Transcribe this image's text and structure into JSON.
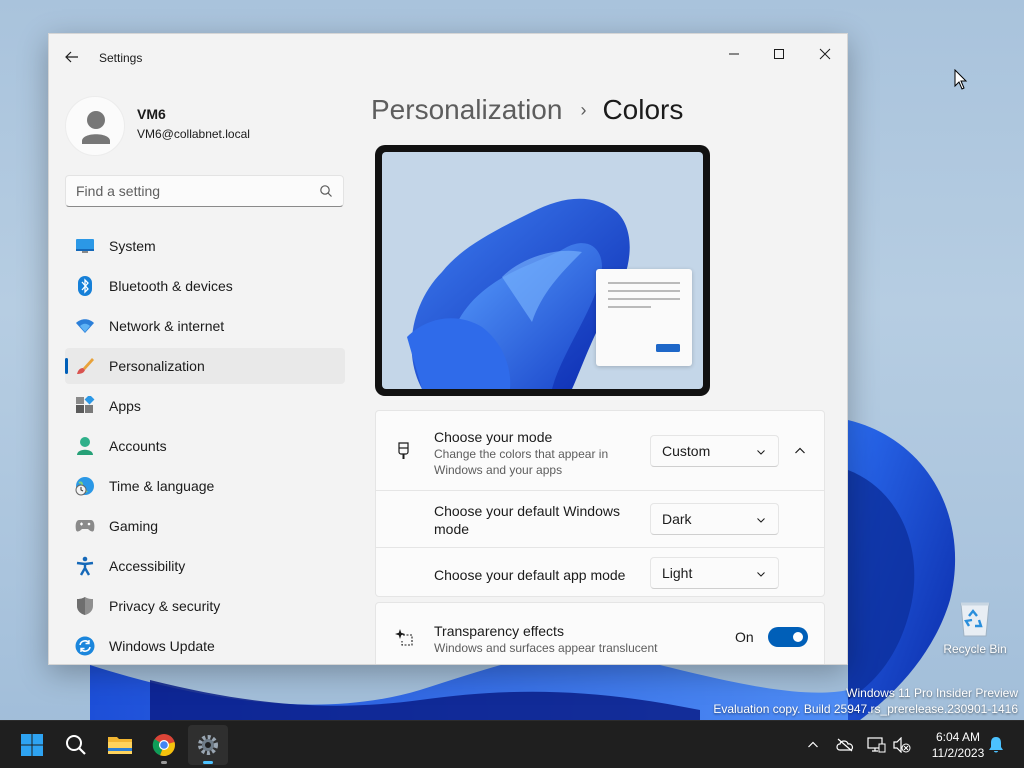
{
  "window": {
    "title": "Settings"
  },
  "profile": {
    "name": "VM6",
    "email": "VM6@collabnet.local"
  },
  "search": {
    "placeholder": "Find a setting"
  },
  "sidebar": {
    "items": [
      {
        "label": "System",
        "icon": "monitor-icon"
      },
      {
        "label": "Bluetooth & devices",
        "icon": "bluetooth-icon"
      },
      {
        "label": "Network & internet",
        "icon": "wifi-icon"
      },
      {
        "label": "Personalization",
        "icon": "paintbrush-icon",
        "active": true
      },
      {
        "label": "Apps",
        "icon": "apps-icon"
      },
      {
        "label": "Accounts",
        "icon": "person-icon"
      },
      {
        "label": "Time & language",
        "icon": "globe-clock-icon"
      },
      {
        "label": "Gaming",
        "icon": "gamepad-icon"
      },
      {
        "label": "Accessibility",
        "icon": "accessibility-icon"
      },
      {
        "label": "Privacy & security",
        "icon": "shield-icon"
      },
      {
        "label": "Windows Update",
        "icon": "update-icon"
      }
    ]
  },
  "main": {
    "breadcrumb_parent": "Personalization",
    "breadcrumb_separator": "›",
    "breadcrumb_current": "Colors",
    "mode_card": {
      "title": "Choose your mode",
      "description": "Change the colors that appear in Windows and your apps",
      "value": "Custom",
      "expanded": true,
      "windows_mode_title": "Choose your default Windows mode",
      "windows_mode_value": "Dark",
      "app_mode_title": "Choose your default app mode",
      "app_mode_value": "Light"
    },
    "transparency_card": {
      "title": "Transparency effects",
      "description": "Windows and surfaces appear translucent",
      "state_label": "On",
      "on": true
    }
  },
  "desktop": {
    "recycle_bin_label": "Recycle Bin",
    "watermark_line1": "Windows 11 Pro Insider Preview",
    "watermark_line2": "Evaluation copy. Build 25947.rs_prerelease.230901-1416"
  },
  "taskbar": {
    "apps": [
      "start-icon",
      "search-icon",
      "file-explorer-icon",
      "chrome-icon",
      "settings-icon"
    ],
    "active_app": "settings-icon",
    "time": "6:04 AM",
    "date": "11/2/2023"
  },
  "colors": {
    "accent": "#005fb8",
    "taskbar": "#1f1f1f",
    "window_bg": "#f3f3f3"
  }
}
